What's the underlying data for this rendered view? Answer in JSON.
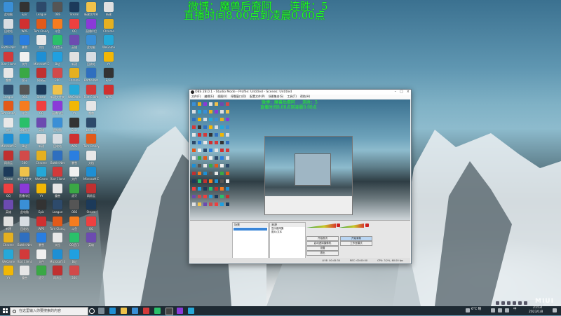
{
  "overlay": {
    "line1_left": "微博：魔兽后裔阿",
    "line1_right": "连胜：5",
    "line2": "直播时间8.00点到凌晨0.00点"
  },
  "desktop_icons": [
    {
      "label": "此电脑",
      "color": "#3a8fd6"
    },
    {
      "label": "回收站",
      "color": "#d8dde2"
    },
    {
      "label": "Battle.Net",
      "color": "#2f6fbf"
    },
    {
      "label": "Riot Client",
      "color": "#d23a3a"
    },
    {
      "label": "魔兽",
      "color": "#e6e6e6"
    },
    {
      "label": "League",
      "color": "#2d4a6b"
    },
    {
      "label": "Tom Clancy",
      "color": "#e25a1a"
    },
    {
      "label": "文档",
      "color": "#e8e8e8"
    },
    {
      "label": "Microsoft Edge",
      "color": "#1e8fd4"
    },
    {
      "label": "网易云",
      "color": "#c03030"
    },
    {
      "label": "Steam",
      "color": "#1c3a5a"
    },
    {
      "label": "QQ",
      "color": "#ee4040"
    },
    {
      "label": "英雄",
      "color": "#6c4bb0"
    },
    {
      "label": "新建",
      "color": "#e0e0e0"
    },
    {
      "label": "Chrome",
      "color": "#e5b020"
    },
    {
      "label": "WeGame",
      "color": "#25a8d8"
    },
    {
      "label": "YY",
      "color": "#f2b705"
    },
    {
      "label": "Epic",
      "color": "#333"
    },
    {
      "label": "WPS",
      "color": "#d03030"
    },
    {
      "label": "暴雪",
      "color": "#2a7ee0"
    },
    {
      "label": "文件",
      "color": "#f0f0f0"
    },
    {
      "label": "虎牙",
      "color": "#3aa845"
    },
    {
      "label": "OBS",
      "color": "#555"
    },
    {
      "label": "斗鱼",
      "color": "#f57c1f"
    },
    {
      "label": "QQ音乐",
      "color": "#2ac06a"
    },
    {
      "label": "B站",
      "color": "#20a0e0"
    },
    {
      "label": "360",
      "color": "#d24a4a"
    },
    {
      "label": "新建文件夹",
      "color": "#f0c24a"
    },
    {
      "label": "直播伴侣",
      "color": "#8a3ad8"
    }
  ],
  "obs": {
    "title": "OBS 28.0.1 - Studio Mode - Profile: Untitled - Scenes: Untitled",
    "menu": [
      "文件(F)",
      "编辑(E)",
      "视图(V)",
      "停靠窗口(D)",
      "配置文件(P)",
      "场景集合(S)",
      "工具(T)",
      "帮助(H)"
    ],
    "docks": {
      "scenes_header": "场景",
      "sources_header": "来源",
      "sources": [
        "显示器采集",
        "图片/文本"
      ],
      "controls": [
        "开始推流",
        "开始录制",
        "启动虚拟摄像机",
        "工作室模式",
        "设置",
        "退出"
      ]
    },
    "status": [
      "LIVE: 00:45:30",
      "REC: 00:00:00",
      "CPU: 3.2%, 60.00 fps"
    ]
  },
  "taskbar": {
    "search_placeholder": "在这里输入你要搜索的内容",
    "tray_temp": "6°C 晴",
    "tray_lang": "中",
    "time": "21:14",
    "date": "2023/1/8"
  },
  "watermark": "MIUI"
}
